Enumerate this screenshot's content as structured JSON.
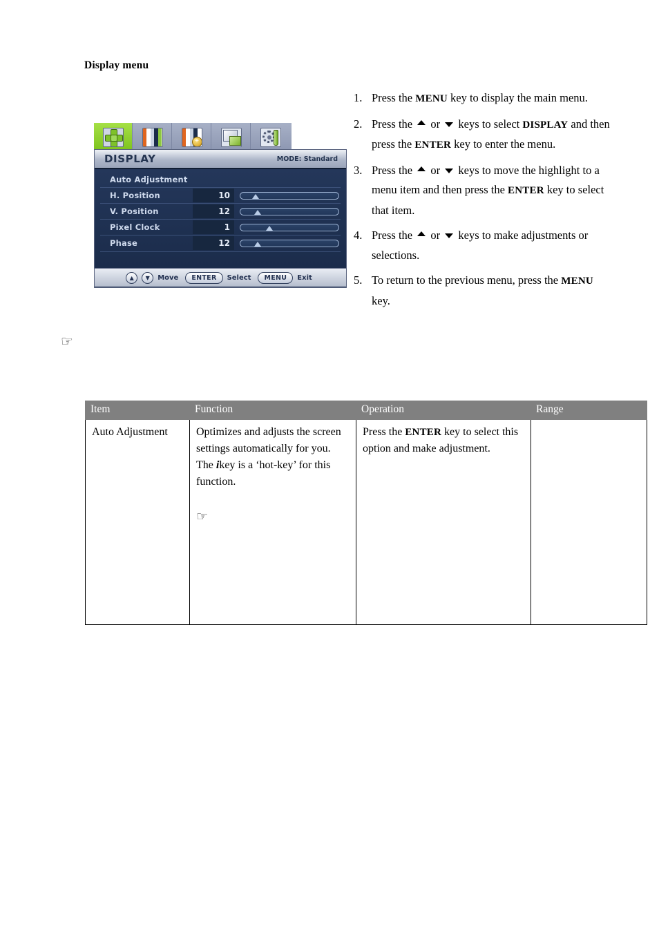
{
  "page": {
    "heading": "Display menu"
  },
  "osd": {
    "tabs": [
      {
        "name": "display-tab",
        "icon": "move-arrows-icon",
        "selected": true
      },
      {
        "name": "picture-tab",
        "icon": "color-bars-icon",
        "selected": false
      },
      {
        "name": "picture-advanced-tab",
        "icon": "color-bars-plus-icon",
        "selected": false
      },
      {
        "name": "audio-tab",
        "icon": "window-overlap-icon",
        "selected": false
      },
      {
        "name": "system-tab",
        "icon": "gear-screwdriver-icon",
        "selected": false
      }
    ],
    "title": "DISPLAY",
    "mode_label": "MODE: Standard",
    "items": [
      {
        "label": "Auto Adjustment",
        "value": "",
        "slider": false,
        "slider_pct": 0
      },
      {
        "label": "H. Position",
        "value": "10",
        "slider": true,
        "slider_pct": 12
      },
      {
        "label": "V. Position",
        "value": "12",
        "slider": true,
        "slider_pct": 14
      },
      {
        "label": "Pixel Clock",
        "value": "1",
        "slider": true,
        "slider_pct": 26
      },
      {
        "label": "Phase",
        "value": "12",
        "slider": true,
        "slider_pct": 14
      }
    ],
    "footer": {
      "up_key": "▲",
      "down_key": "▼",
      "move_label": "Move",
      "enter_key": "ENTER",
      "select_label": "Select",
      "menu_key": "MENU",
      "exit_label": "Exit"
    }
  },
  "steps": [
    {
      "num": "1.",
      "parts": [
        {
          "t": "text",
          "v": "Press the "
        },
        {
          "t": "key",
          "v": "MENU"
        },
        {
          "t": "text",
          "v": " key to display the main menu."
        }
      ]
    },
    {
      "num": "2.",
      "parts": [
        {
          "t": "text",
          "v": "Press the "
        },
        {
          "t": "arrow-up",
          "v": "▲"
        },
        {
          "t": "text",
          "v": " or "
        },
        {
          "t": "arrow-dn",
          "v": "▼"
        },
        {
          "t": "text",
          "v": " keys to select "
        },
        {
          "t": "key",
          "v": "DISPLAY"
        },
        {
          "t": "text",
          "v": " and then press the "
        },
        {
          "t": "key",
          "v": "ENTER"
        },
        {
          "t": "text",
          "v": " key to enter the menu."
        }
      ]
    },
    {
      "num": "3.",
      "parts": [
        {
          "t": "text",
          "v": "Press the "
        },
        {
          "t": "arrow-up",
          "v": "▲"
        },
        {
          "t": "text",
          "v": " or "
        },
        {
          "t": "arrow-dn",
          "v": "▼"
        },
        {
          "t": "text",
          "v": " keys to move the highlight to a menu item and then press the "
        },
        {
          "t": "key",
          "v": "ENTER"
        },
        {
          "t": "text",
          "v": " key to select that item."
        }
      ]
    },
    {
      "num": "4.",
      "parts": [
        {
          "t": "text",
          "v": "Press the "
        },
        {
          "t": "arrow-up",
          "v": "▲"
        },
        {
          "t": "text",
          "v": " or "
        },
        {
          "t": "arrow-dn",
          "v": "▼"
        },
        {
          "t": "text",
          "v": " keys to make adjustments or selections."
        }
      ]
    },
    {
      "num": "5.",
      "parts": [
        {
          "t": "text",
          "v": "To return to the previous menu, press the "
        },
        {
          "t": "key",
          "v": "MENU"
        },
        {
          "t": "text",
          "v": " key."
        }
      ]
    }
  ],
  "note_icon": "☞",
  "table": {
    "headers": [
      "Item",
      "Function",
      "Operation",
      "Range"
    ],
    "rows": [
      {
        "item": "Auto Adjustment",
        "function_parts": [
          {
            "t": "text",
            "v": "Optimizes and adjusts the screen settings automatically for you. The "
          },
          {
            "t": "hotkey",
            "v": "i"
          },
          {
            "t": "text",
            "v": "key is a ‘hot-key’ for this function."
          }
        ],
        "function_note_icon": "☞",
        "operation_parts": [
          {
            "t": "text",
            "v": "Press the "
          },
          {
            "t": "key",
            "v": "ENTER"
          },
          {
            "t": "text",
            "v": " key to select this option and make adjustment."
          }
        ],
        "range": ""
      }
    ]
  },
  "colors": {
    "table_header_bg": "#808080",
    "osd_selected_tab": "#8fd030",
    "osd_body_bg": "#1e3050"
  }
}
